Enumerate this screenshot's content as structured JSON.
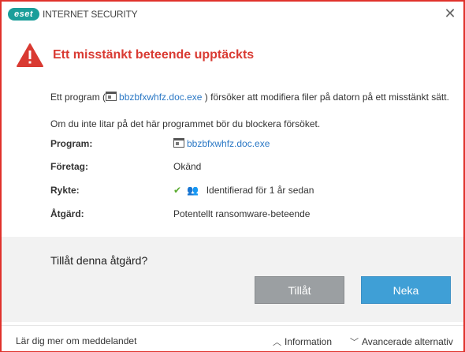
{
  "app": {
    "logo": "eset",
    "product_name": "INTERNET SECURITY",
    "close_symbol": "✕"
  },
  "alert": {
    "title": "Ett misstänkt beteende upptäckts",
    "message_prefix": "Ett program (",
    "message_program": "bbzbfxwhfz.doc.exe",
    "message_suffix": ") försöker att modifiera filer på datorn på ett misstänkt sätt.",
    "advice": "Om du inte litar på det här programmet bör du blockera försöket."
  },
  "details": {
    "program_label": "Program:",
    "program_value": "bbzbfxwhfz.doc.exe",
    "company_label": "Företag:",
    "company_value": "Okänd",
    "reputation_label": "Rykte:",
    "reputation_value": "Identifierad för 1 år sedan",
    "action_label": "Åtgärd:",
    "action_value": "Potentellt ransomware-beteende"
  },
  "prompt": {
    "question": "Tillåt denna åtgärd?",
    "allow_label": "Tillåt",
    "deny_label": "Neka"
  },
  "footer": {
    "learn_more": "Lär dig mer om meddelandet",
    "information": "Information",
    "advanced": "Avancerade alternativ"
  },
  "colors": {
    "alert_red": "#d93a32",
    "link_blue": "#2b78c5",
    "deny_blue": "#3f9fd6",
    "allow_gray": "#9b9fa2",
    "brand_teal": "#1b9e9a"
  }
}
